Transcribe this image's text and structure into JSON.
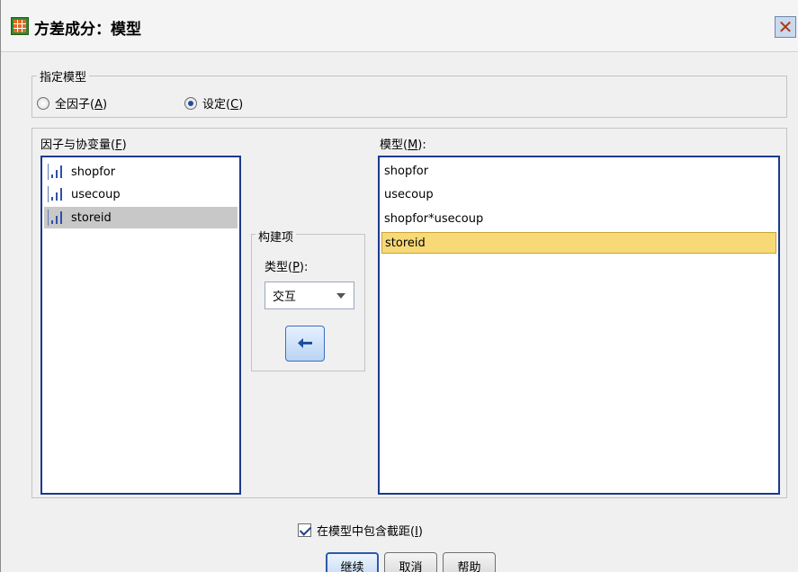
{
  "dialog": {
    "title": "方差成分：模型",
    "close_glyph": "✕"
  },
  "specify_model": {
    "legend": "指定模型",
    "full_factorial": {
      "label": "全因子(A)",
      "text": "全因子(",
      "mnemonic": "A",
      "suffix": ")",
      "checked": false
    },
    "custom": {
      "label": "设定(C)",
      "text": "设定(",
      "mnemonic": "C",
      "suffix": ")",
      "checked": true
    }
  },
  "factors": {
    "label_text": "因子与协变量(",
    "label_mnemonic": "F",
    "label_suffix": ")",
    "items": [
      {
        "name": "shopfor",
        "icon": "scale-ordinal-icon",
        "selected": false
      },
      {
        "name": "usecoup",
        "icon": "scale-ordinal-icon",
        "selected": false
      },
      {
        "name": "storeid",
        "icon": "scale-ordinal-icon",
        "selected": true
      }
    ]
  },
  "build_terms": {
    "legend": "构建项",
    "type_label_text": "类型(",
    "type_label_mnemonic": "P",
    "type_label_suffix": "):",
    "type_value": "交互",
    "move_button_icon": "arrow-left-icon"
  },
  "model": {
    "label_text": "模型(",
    "label_mnemonic": "M",
    "label_suffix": "):",
    "items": [
      {
        "name": "shopfor",
        "selected": false
      },
      {
        "name": "usecoup",
        "selected": false
      },
      {
        "name": "shopfor*usecoup",
        "selected": false
      },
      {
        "name": "storeid",
        "selected": true
      }
    ]
  },
  "include_intercept": {
    "text": "在模型中包含截距(",
    "mnemonic": "I",
    "suffix": ")",
    "checked": true
  },
  "buttons": {
    "continue": "继续",
    "cancel": "取消",
    "help": "帮助"
  },
  "colors": {
    "list_border": "#1b3a8c",
    "selected_model_item": "#f8d978",
    "selected_factor_item": "#c8c8c8"
  }
}
